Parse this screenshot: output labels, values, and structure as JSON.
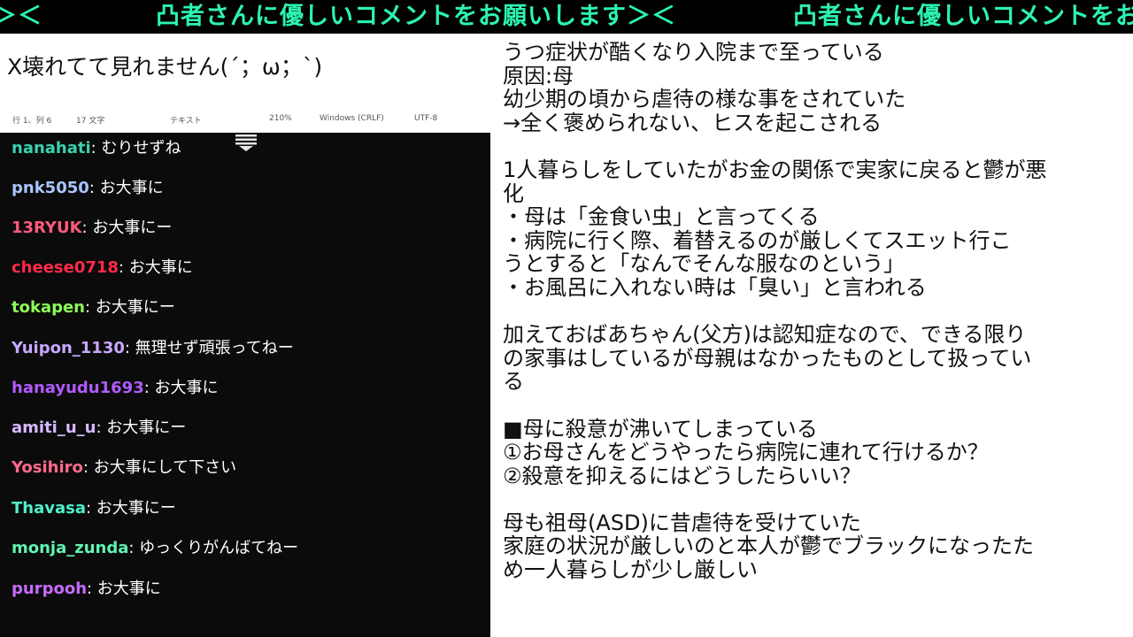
{
  "banner": {
    "segment_left": "＞＜",
    "segment_main": "凸者さんに優しいコメントをお願いします＞＜",
    "segment_right": "凸者さんに優しいコメントをお",
    "color": "#2cf4b0"
  },
  "notepad": {
    "text": "X壊れてて見れません(´；ω；`)",
    "status": {
      "position": "行 1、列 6",
      "chars": "17 文字",
      "type": "テキスト",
      "zoom": "210%",
      "line_ending": "Windows (CRLF)",
      "encoding": "UTF-8"
    }
  },
  "chat": {
    "handle_icon": "scroll-handle-icon",
    "messages": [
      {
        "user": "nanahati",
        "msg": ": むりせずね",
        "color": "#39d3b0"
      },
      {
        "user": "pnk5050",
        "msg": ": お大事に",
        "color": "#a9c5ff"
      },
      {
        "user": "13RYUK",
        "msg": ": お大事にー",
        "color": "#ff5a7a"
      },
      {
        "user": "cheese0718",
        "msg": ": お大事に",
        "color": "#ff2a4a"
      },
      {
        "user": "tokapen",
        "msg": ": お大事にー",
        "color": "#8cff5a"
      },
      {
        "user": "Yuipon_1130",
        "msg": ": 無理せず頑張ってねー",
        "color": "#c8a8ff"
      },
      {
        "user": "hanayudu1693",
        "msg": ": お大事に",
        "color": "#b05aff"
      },
      {
        "user": "amiti_u_u",
        "msg": ": お大事にー",
        "color": "#d7b8ff"
      },
      {
        "user": "Yosihiro",
        "msg": ": お大事にして下さい",
        "color": "#ff6a8a"
      },
      {
        "user": "Thavasa",
        "msg": ": お大事にー",
        "color": "#4ff0c8"
      },
      {
        "user": "monja_zunda",
        "msg": ": ゆっくりがんばてねー",
        "color": "#5ff5b0"
      },
      {
        "user": "purpooh",
        "msg": ": お大事に",
        "color": "#c86aff"
      }
    ]
  },
  "document": {
    "lines": [
      "うつ症状が酷くなり入院まで至っている",
      "原因:母",
      "幼少期の頃から虐待の様な事をされていた",
      "→全く褒められない、ヒスを起こされる",
      "",
      "1人暮らしをしていたがお金の関係で実家に戻ると鬱が悪",
      "化",
      "・母は「金食い虫」と言ってくる",
      "・病院に行く際、着替えるのが厳しくてスエット行こ",
      "うとすると「なんでそんな服なのという」",
      "・お風呂に入れない時は「臭い」と言われる",
      "",
      "加えておばあちゃん(父方)は認知症なので、できる限り",
      "の家事はしているが母親はなかったものとして扱ってい",
      "る",
      "",
      "■母に殺意が沸いてしまっている",
      "①お母さんをどうやったら病院に連れて行けるか？",
      "②殺意を抑えるにはどうしたらいい？",
      "",
      "母も祖母(ASD)に昔虐待を受けていた",
      "家庭の状況が厳しいのと本人が鬱でブラックになったた",
      "め一人暮らしが少し厳しい"
    ]
  }
}
